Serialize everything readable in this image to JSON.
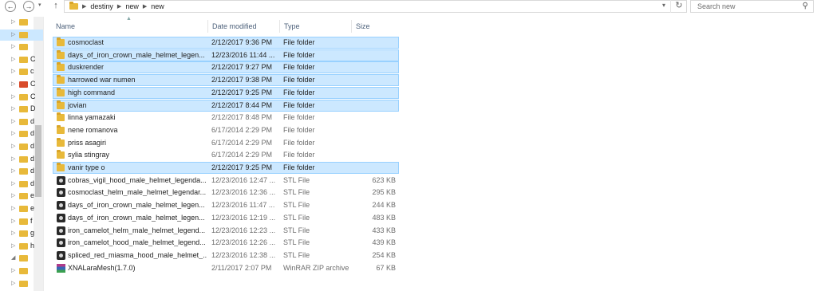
{
  "toolbar": {
    "back_icon": "back-arrow-icon",
    "forward_icon": "forward-arrow-icon",
    "up_icon": "up-arrow-icon",
    "breadcrumbs": [
      "destiny",
      "new",
      "new"
    ],
    "refresh_icon": "refresh-icon",
    "search_placeholder": "Search new",
    "search_icon": "search-icon"
  },
  "nav_pane": {
    "items": [
      {
        "label": "",
        "icon": "folder-icon"
      },
      {
        "label": "",
        "icon": "folder-icon"
      },
      {
        "label": "",
        "icon": "folder-icon"
      },
      {
        "label": "C",
        "icon": "folder-icon"
      },
      {
        "label": "c",
        "icon": "folder-icon"
      },
      {
        "label": "C",
        "icon": "app-icon"
      },
      {
        "label": "C",
        "icon": "folder-icon"
      },
      {
        "label": "D",
        "icon": "folder-icon"
      },
      {
        "label": "d",
        "icon": "folder-icon"
      },
      {
        "label": "d",
        "icon": "folder-icon"
      },
      {
        "label": "d",
        "icon": "folder-icon"
      },
      {
        "label": "d",
        "icon": "folder-icon"
      },
      {
        "label": "d",
        "icon": "folder-icon"
      },
      {
        "label": "d",
        "icon": "folder-icon"
      },
      {
        "label": "e",
        "icon": "folder-icon"
      },
      {
        "label": "e",
        "icon": "folder-icon"
      },
      {
        "label": "f",
        "icon": "folder-icon"
      },
      {
        "label": "g",
        "icon": "folder-icon"
      },
      {
        "label": "h",
        "icon": "folder-icon"
      },
      {
        "label": "",
        "icon": "folder-icon"
      },
      {
        "label": "",
        "icon": "folder-icon"
      },
      {
        "label": "",
        "icon": "folder-icon"
      }
    ]
  },
  "columns": {
    "name": "Name",
    "date": "Date modified",
    "type": "Type",
    "size": "Size"
  },
  "files": [
    {
      "name": "cosmoclast",
      "date": "2/12/2017 9:36 PM",
      "type": "File folder",
      "size": "",
      "kind": "folder",
      "selected": true
    },
    {
      "name": "days_of_iron_crown_male_helmet_legen...",
      "date": "12/23/2016 11:44 ...",
      "type": "File folder",
      "size": "",
      "kind": "folder",
      "selected": true
    },
    {
      "name": "duskrender",
      "date": "2/12/2017 9:27 PM",
      "type": "File folder",
      "size": "",
      "kind": "folder",
      "selected": true
    },
    {
      "name": "harrowed war numen",
      "date": "2/12/2017 9:38 PM",
      "type": "File folder",
      "size": "",
      "kind": "folder",
      "selected": true
    },
    {
      "name": "high command",
      "date": "2/12/2017 9:25 PM",
      "type": "File folder",
      "size": "",
      "kind": "folder",
      "selected": true
    },
    {
      "name": "jovian",
      "date": "2/12/2017 8:44 PM",
      "type": "File folder",
      "size": "",
      "kind": "folder",
      "selected": true
    },
    {
      "name": "linna yamazaki",
      "date": "2/12/2017 8:48 PM",
      "type": "File folder",
      "size": "",
      "kind": "folder",
      "selected": false
    },
    {
      "name": "nene romanova",
      "date": "6/17/2014 2:29 PM",
      "type": "File folder",
      "size": "",
      "kind": "folder",
      "selected": false
    },
    {
      "name": "priss asagiri",
      "date": "6/17/2014 2:29 PM",
      "type": "File folder",
      "size": "",
      "kind": "folder",
      "selected": false
    },
    {
      "name": "sylia stingray",
      "date": "6/17/2014 2:29 PM",
      "type": "File folder",
      "size": "",
      "kind": "folder",
      "selected": false
    },
    {
      "name": "vanir type o",
      "date": "2/12/2017 9:25 PM",
      "type": "File folder",
      "size": "",
      "kind": "folder",
      "selected": true
    },
    {
      "name": "cobras_vigil_hood_male_helmet_legenda...",
      "date": "12/23/2016 12:47 ...",
      "type": "STL File",
      "size": "623 KB",
      "kind": "stl",
      "selected": false
    },
    {
      "name": "cosmoclast_helm_male_helmet_legendar...",
      "date": "12/23/2016 12:36 ...",
      "type": "STL File",
      "size": "295 KB",
      "kind": "stl",
      "selected": false
    },
    {
      "name": "days_of_iron_crown_male_helmet_legen...",
      "date": "12/23/2016 11:47 ...",
      "type": "STL File",
      "size": "244 KB",
      "kind": "stl",
      "selected": false
    },
    {
      "name": "days_of_iron_crown_male_helmet_legen...",
      "date": "12/23/2016 12:19 ...",
      "type": "STL File",
      "size": "483 KB",
      "kind": "stl",
      "selected": false
    },
    {
      "name": "iron_camelot_helm_male_helmet_legend...",
      "date": "12/23/2016 12:23 ...",
      "type": "STL File",
      "size": "433 KB",
      "kind": "stl",
      "selected": false
    },
    {
      "name": "iron_camelot_hood_male_helmet_legend...",
      "date": "12/23/2016 12:26 ...",
      "type": "STL File",
      "size": "439 KB",
      "kind": "stl",
      "selected": false
    },
    {
      "name": "spliced_red_miasma_hood_male_helmet_...",
      "date": "12/23/2016 12:38 ...",
      "type": "STL File",
      "size": "254 KB",
      "kind": "stl",
      "selected": false
    },
    {
      "name": "XNALaraMesh(1.7.0)",
      "date": "2/11/2017 2:07 PM",
      "type": "WinRAR ZIP archive",
      "size": "67 KB",
      "kind": "zip",
      "selected": false
    }
  ],
  "colors": {
    "selection_fill": "#cce8ff",
    "selection_border": "#99d1ff",
    "folder": "#e8b93a"
  }
}
